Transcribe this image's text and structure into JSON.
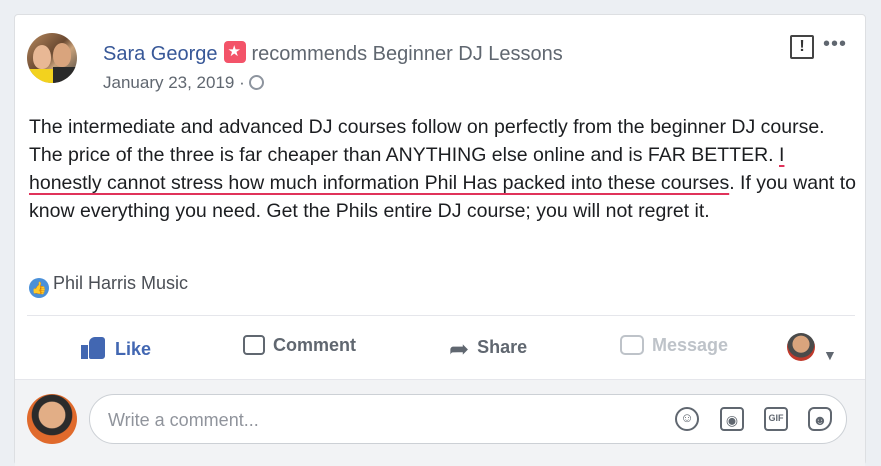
{
  "post": {
    "author": "Sara George",
    "action_text": "recommends Beginner DJ Lessons",
    "date": "January 23, 2019",
    "date_separator": "·",
    "text_part1": "The intermediate and advanced DJ courses follow on perfectly from the beginner DJ course. The price of the three is far cheaper than ANYTHING else online and is FAR BETTER. ",
    "text_highlighted": "I honestly cannot stress how much information Phil Has packed into these courses",
    "text_part2": ". If you want to know everything you need. Get the Phils entire DJ course; you will not regret it.",
    "page_tag": "Phil Harris Music"
  },
  "actions": {
    "like": "Like",
    "comment": "Comment",
    "share": "Share",
    "message": "Message"
  },
  "comment_box": {
    "placeholder": "Write a comment..."
  },
  "icons": {
    "recommend": "recommend-star-icon",
    "globe": "globe-icon",
    "report": "report-icon",
    "more": "more-options-icon",
    "like": "thumbs-up-icon",
    "comment": "comment-bubble-icon",
    "share": "share-arrow-icon",
    "message": "message-icon",
    "emoji": "smiley-icon",
    "camera": "camera-icon",
    "gif": "gif-icon",
    "sticker": "sticker-icon",
    "caret": "chevron-down-icon"
  },
  "colors": {
    "link_blue": "#385898",
    "like_blue": "#4267b2",
    "recommend_pink": "#f35369",
    "highlight_underline": "#e0325a"
  }
}
